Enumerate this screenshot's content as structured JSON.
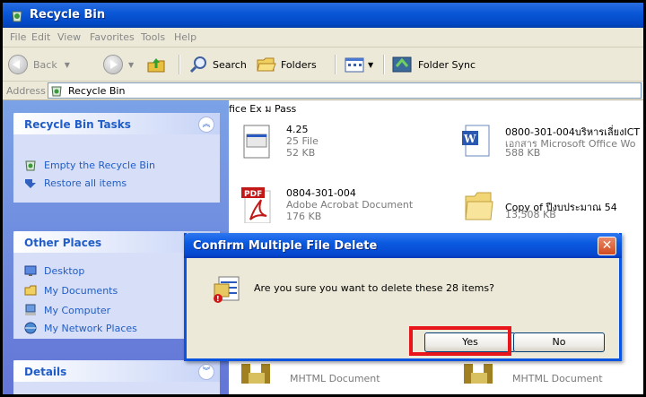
{
  "window": {
    "title": "Recycle Bin"
  },
  "menu": [
    "File",
    "Edit",
    "View",
    "Favorites",
    "Tools",
    "Help"
  ],
  "toolbar": {
    "back": "Back",
    "search": "Search",
    "folders": "Folders",
    "folder_sync": "Folder Sync"
  },
  "address": {
    "label": "Address",
    "value": "Recycle Bin"
  },
  "sidebar": {
    "tasks": {
      "title": "Recycle Bin Tasks",
      "items": [
        "Empty the Recycle Bin",
        "Restore all items"
      ]
    },
    "other_places": {
      "title": "Other Places",
      "items": [
        "Desktop",
        "My Documents",
        "My Computer",
        "My Network Places"
      ]
    },
    "details": {
      "title": "Details"
    }
  },
  "files": [
    {
      "name": "4.25",
      "type": "25 File",
      "size": "52 KB"
    },
    {
      "name": "0800-301-004บริหารเลี่ยงICT",
      "type": "เอกสาร Microsoft Office Wo",
      "size": "588 KB"
    },
    {
      "name": "0804-301-004",
      "type": "Adobe Acrobat Document",
      "size": "176 KB"
    },
    {
      "name": "Copy of ปีงบประมาณ 54",
      "type": "13,508 KB"
    },
    {
      "type": "fice Ex"
    },
    {
      "type": "ม Pass"
    },
    {
      "type": "MHTML Document"
    },
    {
      "type": "MHTML Document"
    }
  ],
  "dialog": {
    "title": "Confirm Multiple File Delete",
    "message": "Are you sure you want to delete these 28 items?",
    "yes": "Yes",
    "no": "No"
  },
  "colors": {
    "titlebar": "#0a58d8",
    "sidebar_link": "#215dc6",
    "highlight": "#e8151b"
  }
}
